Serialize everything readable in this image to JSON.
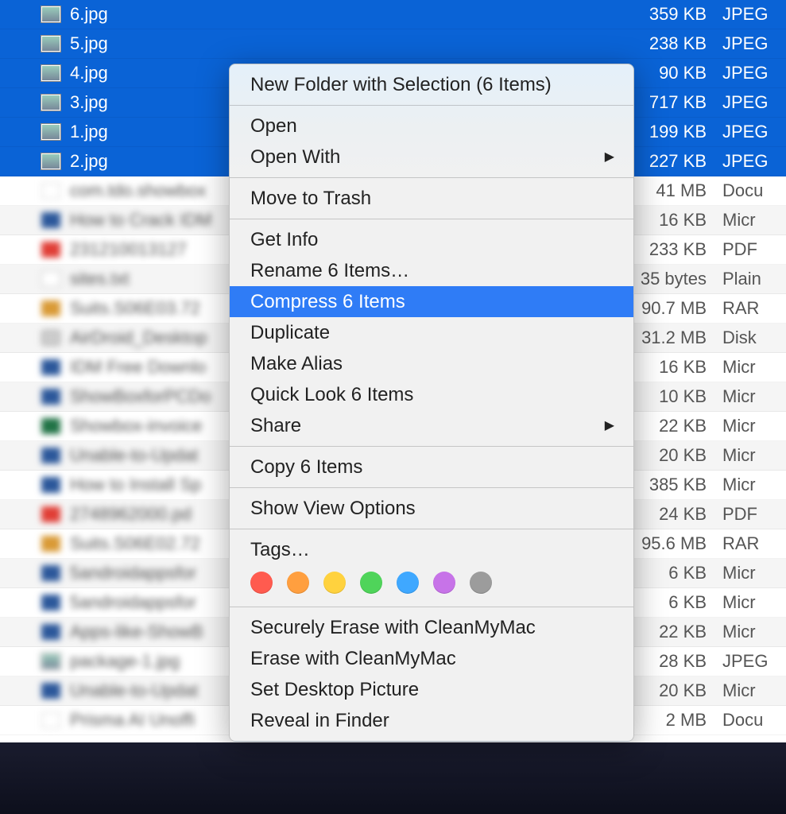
{
  "files": [
    {
      "name": "6.jpg",
      "size": "359 KB",
      "kind": "JPEG",
      "selected": true,
      "iconClass": "jpg"
    },
    {
      "name": "5.jpg",
      "size": "238 KB",
      "kind": "JPEG",
      "selected": true,
      "iconClass": "jpg"
    },
    {
      "name": "4.jpg",
      "size": "90 KB",
      "kind": "JPEG",
      "selected": true,
      "iconClass": "jpg"
    },
    {
      "name": "3.jpg",
      "size": "717 KB",
      "kind": "JPEG",
      "selected": true,
      "iconClass": "jpg"
    },
    {
      "name": "1.jpg",
      "size": "199 KB",
      "kind": "JPEG",
      "selected": true,
      "iconClass": "jpg"
    },
    {
      "name": "2.jpg",
      "size": "227 KB",
      "kind": "JPEG",
      "selected": true,
      "iconClass": "jpg"
    },
    {
      "name": "com.tdo.showbox",
      "size": "41 MB",
      "kind": "Docu",
      "selected": false,
      "blurred": true,
      "iconClass": "blank"
    },
    {
      "name": "How to Crack IDM",
      "size": "16 KB",
      "kind": "Micr",
      "selected": false,
      "blurred": true,
      "iconClass": "doc"
    },
    {
      "name": "231210013127",
      "size": "233 KB",
      "kind": "PDF",
      "selected": false,
      "blurred": true,
      "iconClass": "pdf"
    },
    {
      "name": "sites.txt",
      "size": "35 bytes",
      "kind": "Plain",
      "selected": false,
      "blurred": true,
      "iconClass": "txt"
    },
    {
      "name": "Suits.S06E03.72",
      "size": "90.7 MB",
      "kind": "RAR",
      "selected": false,
      "blurred": true,
      "iconClass": "rar"
    },
    {
      "name": "AirDroid_Desktop",
      "size": "31.2 MB",
      "kind": "Disk",
      "selected": false,
      "blurred": true,
      "iconClass": "dmg"
    },
    {
      "name": "IDM Free Downlo",
      "size": "16 KB",
      "kind": "Micr",
      "selected": false,
      "blurred": true,
      "iconClass": "doc"
    },
    {
      "name": "ShowBoxforPCDo",
      "size": "10 KB",
      "kind": "Micr",
      "selected": false,
      "blurred": true,
      "iconClass": "doc"
    },
    {
      "name": "Showbox-invoice",
      "size": "22 KB",
      "kind": "Micr",
      "selected": false,
      "blurred": true,
      "iconClass": "xls"
    },
    {
      "name": "Unable-to-Updat",
      "size": "20 KB",
      "kind": "Micr",
      "selected": false,
      "blurred": true,
      "iconClass": "doc"
    },
    {
      "name": "How to Install Sp",
      "size": "385 KB",
      "kind": "Micr",
      "selected": false,
      "blurred": true,
      "iconClass": "doc"
    },
    {
      "name": "2748962000.pd",
      "size": "24 KB",
      "kind": "PDF",
      "selected": false,
      "blurred": true,
      "iconClass": "pdf"
    },
    {
      "name": "Suits.S06E02.72",
      "size": "95.6 MB",
      "kind": "RAR",
      "selected": false,
      "blurred": true,
      "iconClass": "rar"
    },
    {
      "name": "5androidappsfor",
      "size": "6 KB",
      "kind": "Micr",
      "selected": false,
      "blurred": true,
      "iconClass": "doc"
    },
    {
      "name": "5androidappsfor",
      "size": "6 KB",
      "kind": "Micr",
      "selected": false,
      "blurred": true,
      "iconClass": "doc"
    },
    {
      "name": "Apps-like-ShowB",
      "size": "22 KB",
      "kind": "Micr",
      "selected": false,
      "blurred": true,
      "iconClass": "doc"
    },
    {
      "name": "package-1.jpg",
      "size": "28 KB",
      "kind": "JPEG",
      "selected": false,
      "blurred": true,
      "iconClass": "jpg"
    },
    {
      "name": "Unable-to-Updat",
      "size": "20 KB",
      "kind": "Micr",
      "selected": false,
      "blurred": true,
      "iconClass": "doc"
    },
    {
      "name": "Prisma AI Unoffi",
      "size": "2 MB",
      "kind": "Docu",
      "selected": false,
      "blurred": true,
      "iconClass": "blank"
    }
  ],
  "contextMenu": {
    "newFolder": "New Folder with Selection (6 Items)",
    "open": "Open",
    "openWith": "Open With",
    "moveToTrash": "Move to Trash",
    "getInfo": "Get Info",
    "rename": "Rename 6 Items…",
    "compress": "Compress 6 Items",
    "duplicate": "Duplicate",
    "makeAlias": "Make Alias",
    "quickLook": "Quick Look 6 Items",
    "share": "Share",
    "copy": "Copy 6 Items",
    "showViewOptions": "Show View Options",
    "tags": "Tags…",
    "securelyErase": "Securely Erase with CleanMyMac",
    "erase": "Erase with CleanMyMac",
    "setDesktop": "Set Desktop Picture",
    "revealInFinder": "Reveal in Finder"
  },
  "tagColors": [
    "#ff5b4f",
    "#ff9f3f",
    "#ffd23e",
    "#4fd45a",
    "#3fa8ff",
    "#c773e8",
    "#9c9c9c"
  ]
}
